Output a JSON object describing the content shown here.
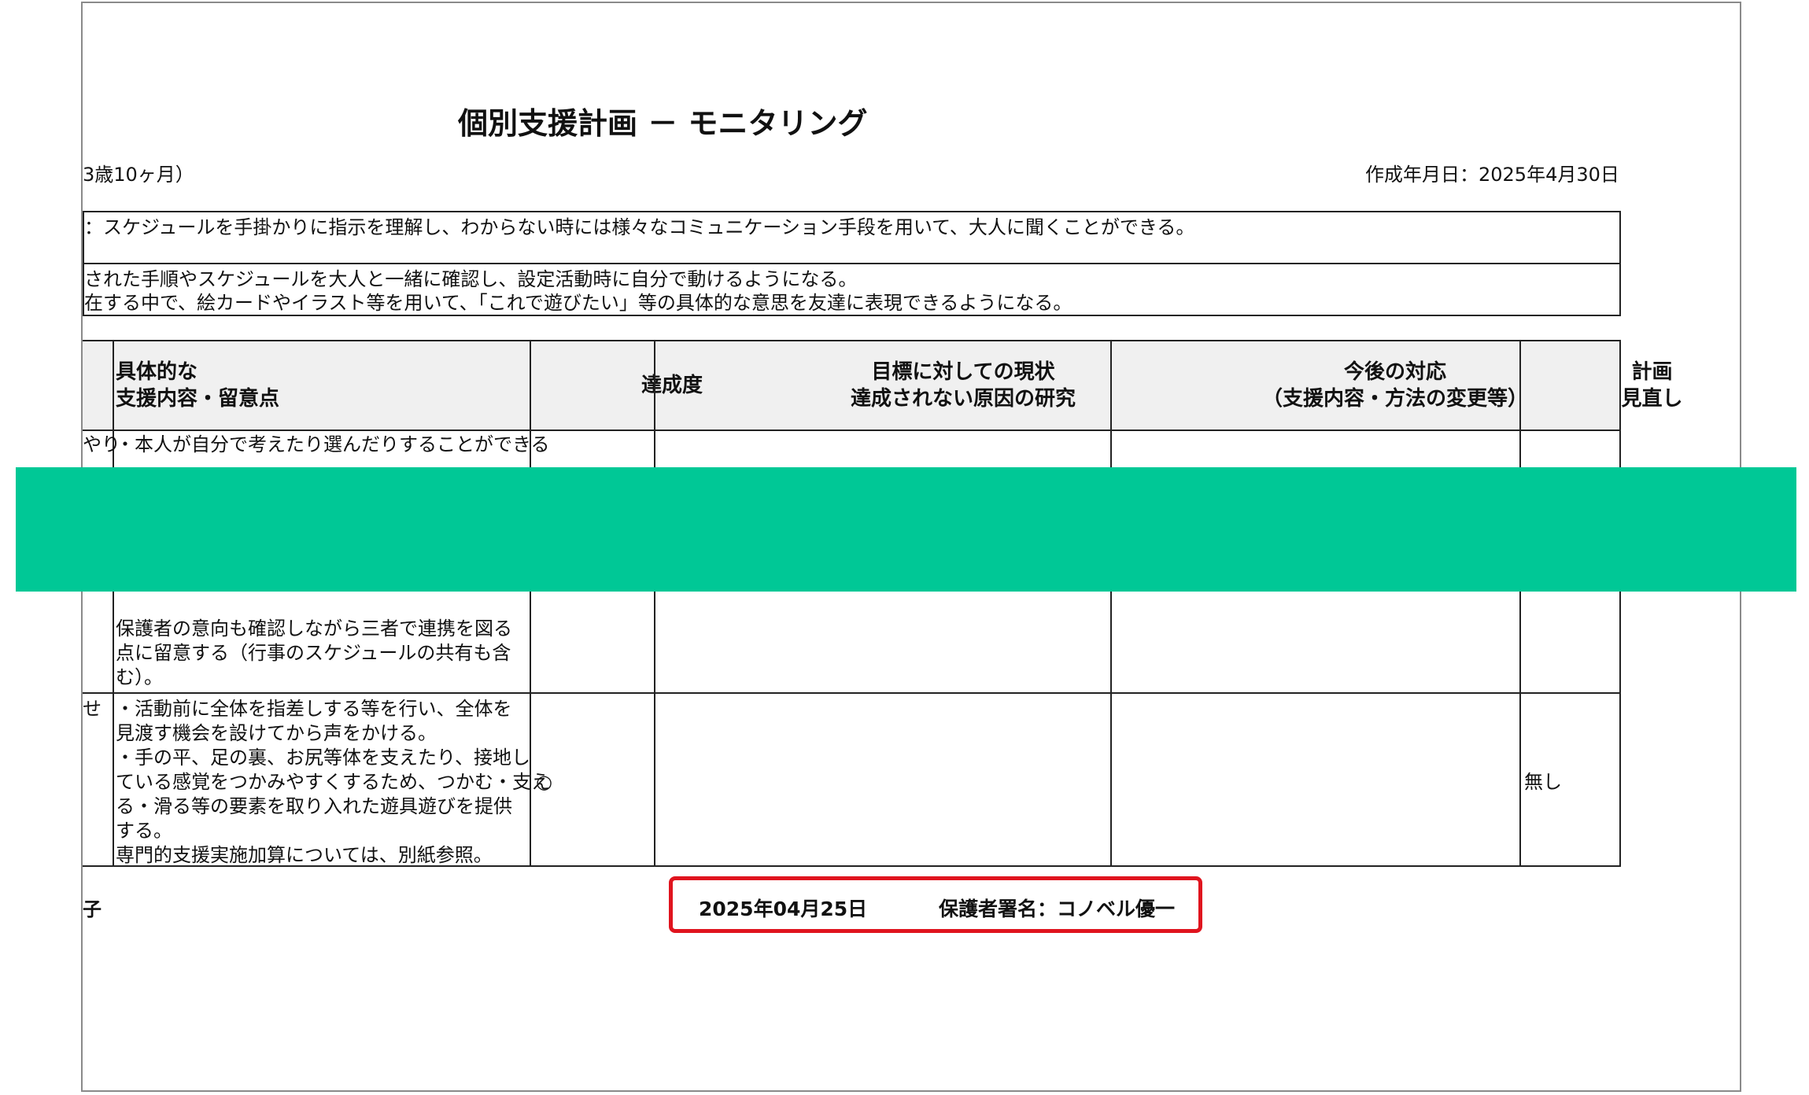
{
  "document": {
    "title": "個別支援計画 － モニタリング",
    "age_fragment": "3歳10ヶ月）",
    "created_date": "作成年月日：2025年4月30日",
    "goal_long": "：スケジュールを手掛かりに指示を理解し、わからない時には様々なコミュニケーション手段を用いて、大人に聞くことができる。",
    "goal_short_1": "された手順やスケジュールを大人と一緒に確認し、設定活動時に自分で動けるようになる。",
    "goal_short_2": "在する中で、絵カードやイラスト等を用いて、「これで遊びたい」等の具体的な意思を友達に表現できるようになる。"
  },
  "table": {
    "headers": {
      "support": "具体的な\n支援内容・留意点",
      "achievement": "達成度",
      "status": "目標に対しての現状\n達成されない原因の研究",
      "future": "今後の対応\n（支援内容・方法の変更等）",
      "review": "計画\n見直し"
    },
    "row1": {
      "lead_fragment": "やり",
      "support_first_line": "・本人が自分で考えたり選んだりすることができる",
      "support_tail": [
        "保護者の意向も確認しながら三者で連携を図る",
        "点に留意する（行事のスケジュールの共有も含",
        "む）。"
      ]
    },
    "row2": {
      "lead_fragment": "せ",
      "support": [
        "・活動前に全体を指差しする等を行い、全体を",
        "見渡す機会を設けてから声をかける。",
        "・手の平、足の裏、お尻等体を支えたり、接地し",
        "ている感覚をつかみやすくするため、つかむ・支え",
        "る・滑る等の要素を取り入れた遊具遊びを提供",
        "する。",
        "専門的支援実施加算については、別紙参照。"
      ],
      "achievement": "○",
      "review": "無し"
    }
  },
  "footer": {
    "child_fragment": "子",
    "signature_date": "2025年04月25日",
    "guardian_signature": "保護者署名：コノベル優一"
  },
  "colors": {
    "overlay": "#00c896",
    "highlight": "#e0141e",
    "header_bg": "#f0f0f0"
  }
}
